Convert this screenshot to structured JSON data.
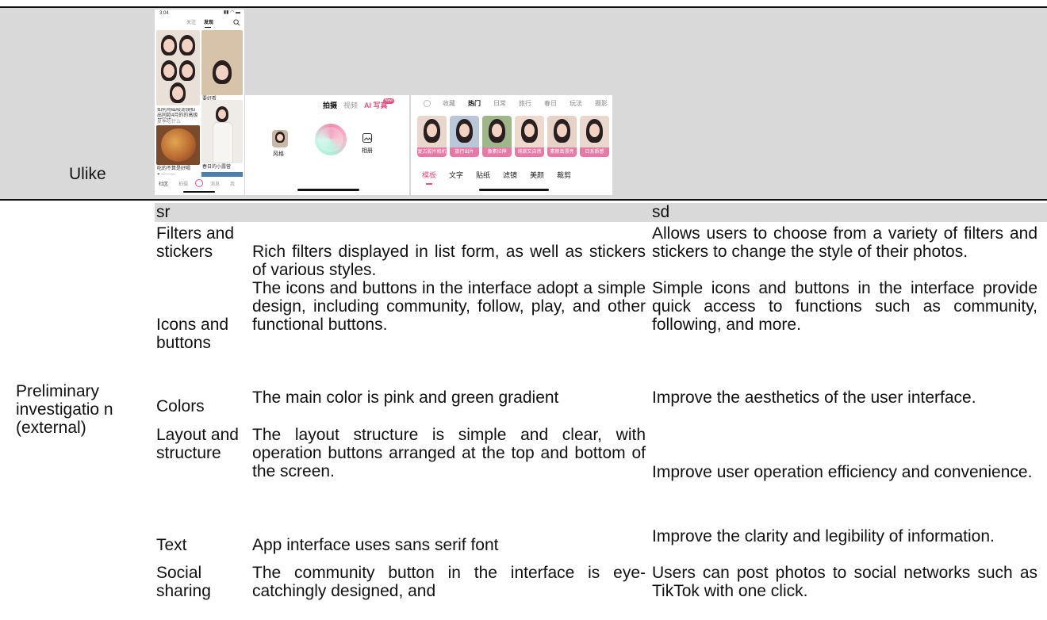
{
  "row1": {
    "app_label": "Ulike"
  },
  "phone_feed": {
    "status_time": "3:04",
    "tab_follow": "关注",
    "tab_discover": "发现",
    "card1_title": "如何用磁吸滤镜拍出同款4月的的高级氛围感",
    "card1_author": "夏季吃什么",
    "card2_title": "要好看",
    "card3_title": "吃的不算是好喝",
    "card4_title": "春日的小露营",
    "nav_items": [
      "社区",
      "拍摄",
      "",
      "消息",
      "我"
    ]
  },
  "phone_camera": {
    "mode_photo": "拍摄",
    "mode_video": "视频",
    "mode_ai": "AI 写真",
    "badge_new": "New",
    "style_label": "风格",
    "album_label": "相册"
  },
  "phone_filters": {
    "categories": [
      "收藏",
      "热门",
      "日常",
      "旅行",
      "春日",
      "玩法",
      "摄影"
    ],
    "thumb_labels": [
      "复古胶片相机",
      "旅行出片",
      "像素拉伸",
      "纯欲又自然",
      "素颜真漂亮",
      "日系质感"
    ],
    "tabs": [
      "模板",
      "文字",
      "贴纸",
      "滤镜",
      "美颜",
      "裁剪"
    ]
  },
  "table": {
    "section_label": "Preliminary investigatio n (external)",
    "header_left": "sr",
    "header_right": "sd",
    "rows": [
      {
        "name": "Filters and stickers",
        "desc": "Rich filters displayed in list form, as well as stickers of various styles.",
        "purpose": "Allows users to choose from a variety of filters and stickers to change the style of their photos."
      },
      {
        "name": "Icons and buttons",
        "desc": "The icons and buttons in the interface adopt a simple design, including community, follow, play, and other functional buttons.",
        "purpose": "Simple icons and buttons in the interface provide quick access to functions such as community, following, and more."
      },
      {
        "name": "Colors",
        "desc": "The main color is pink and green gradient",
        "purpose": "Improve the aesthetics of the user interface."
      },
      {
        "name": "Layout and structure",
        "desc": "The layout structure is simple and clear, with operation buttons arranged at the top and bottom of the screen.",
        "purpose": "Improve user operation efficiency and convenience."
      },
      {
        "name": "Text",
        "desc": "App interface uses sans serif font",
        "purpose": "Improve the clarity and legibility of information."
      },
      {
        "name": "Social sharing",
        "desc": "The community button in the interface is eye-catchingly designed, and",
        "purpose": "Users can post photos to social networks such as TikTok with one click."
      }
    ]
  },
  "colors": {
    "header_grey": "#d9d9d9",
    "accent_pink": "#e2537f",
    "ring_pink": "#f08bb0",
    "ring_green": "#a9f0d8"
  }
}
